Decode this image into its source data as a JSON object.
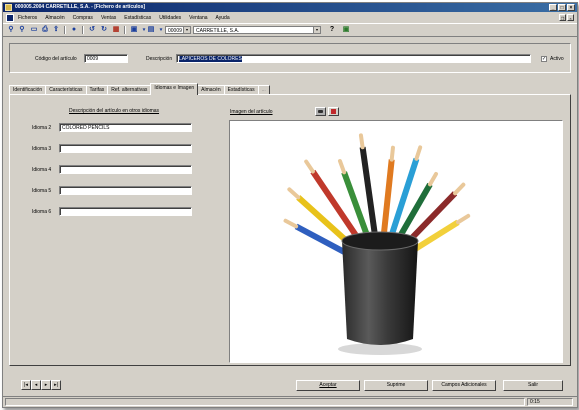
{
  "window": {
    "title": "000005.2004 CARRETILLE, S.A. - [Fichero de artículos]",
    "controls": [
      "_",
      "□",
      "×"
    ]
  },
  "menu": {
    "items": [
      "Ficheros",
      "Almacén",
      "Compras",
      "Ventas",
      "Estadísticas",
      "Utilidades",
      "Ventana",
      "Ayuda"
    ]
  },
  "toolbar": {
    "company_code": "00009",
    "company_name": "CARRETILLE, S.A.",
    "help_glyph": "?"
  },
  "header": {
    "code_label": "Código del artículo",
    "code_value": "0009",
    "desc_label": "Descripción",
    "desc_value": "LAPICEROS DE COLORES",
    "active_label": "Activo",
    "active_checked": true
  },
  "tabs": [
    {
      "label": "Identificación"
    },
    {
      "label": "Características"
    },
    {
      "label": "Tarifas"
    },
    {
      "label": "Ref. alternativas"
    },
    {
      "label": "Idiomas e Imagen"
    },
    {
      "label": "Almacén"
    },
    {
      "label": "Estadísticas"
    },
    {
      "label": "..."
    }
  ],
  "languages": {
    "heading": "Descripción del artículo en otros idiomas",
    "rows": [
      {
        "label": "Idioma 2",
        "value": "COLORED PENCILS"
      },
      {
        "label": "Idioma 3",
        "value": ""
      },
      {
        "label": "Idioma 4",
        "value": ""
      },
      {
        "label": "Idioma 5",
        "value": ""
      },
      {
        "label": "Idioma 6",
        "value": ""
      }
    ]
  },
  "image": {
    "heading": "Imagen del artículo",
    "pencil_colors": [
      "#2f5fbf",
      "#e8c21a",
      "#c0392b",
      "#3a8f3a",
      "#222222",
      "#e07a20",
      "#2a9fd6",
      "#1f6e3a",
      "#8b2a2a",
      "#f2d03b"
    ]
  },
  "nav": {
    "first": "|◂",
    "prev": "◂",
    "next": "▸",
    "last": "▸|"
  },
  "actions": {
    "accept": "Aceptar",
    "delete": "Suprime",
    "extra_fields": "Campos Adicionales",
    "exit": "Salir"
  },
  "status": {
    "time": "0:15"
  }
}
